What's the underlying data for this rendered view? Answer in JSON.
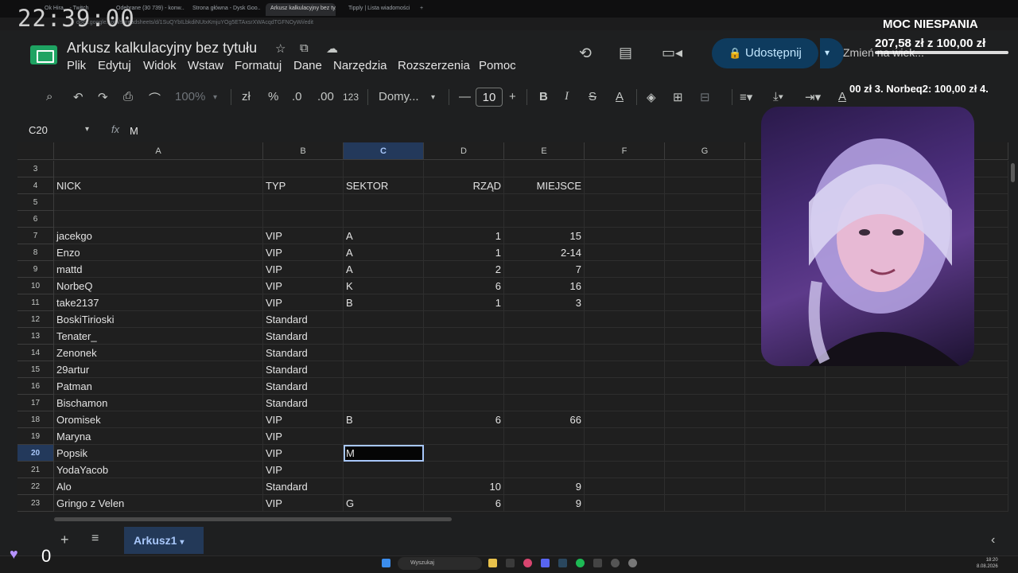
{
  "clock": "22:39:00",
  "browser_tabs": [
    "Ok Hira... - Twitch",
    "Odebrane (30 739) - konw...",
    "Strona główna - Dysk Goo...",
    "Arkusz kalkulacyjny bez ty...",
    "Tipply | Lista wiadomości"
  ],
  "url": "docs.google.com/spreadsheets/d/1SuQYbILbkdiNUtxKmjuYOg5ETAxsrXWAcqdTGFNOyWi/edit",
  "doc_title": "Arkusz kalkulacyjny bez tytułu",
  "menu": [
    "Plik",
    "Edytuj",
    "Widok",
    "Wstaw",
    "Formatuj",
    "Dane",
    "Narzędzia",
    "Rozszerzenia",
    "Pomoc"
  ],
  "share_label": "Udostępnij",
  "rename_label": "Zmień na wiek...",
  "toolbar": {
    "zoom": "100%",
    "currency": "zł",
    "percent": "%",
    "dec_less": ".0",
    "dec_more": ".00",
    "format": "123",
    "font": "Domy...",
    "font_size": "10"
  },
  "namebox": "C20",
  "formula_value": "M",
  "columns": [
    "A",
    "B",
    "C",
    "D",
    "E",
    "F",
    "G"
  ],
  "rows": [
    {
      "n": "3",
      "a": "",
      "b": "",
      "c": "",
      "d": "",
      "e": ""
    },
    {
      "n": "4",
      "a": "NICK",
      "b": "TYP",
      "c": "SEKTOR",
      "d": "RZĄD",
      "e": "MIEJSCE"
    },
    {
      "n": "5",
      "a": "",
      "b": "",
      "c": "",
      "d": "",
      "e": ""
    },
    {
      "n": "6",
      "a": "",
      "b": "",
      "c": "",
      "d": "",
      "e": ""
    },
    {
      "n": "7",
      "a": "jacekgo",
      "b": "VIP",
      "c": "A",
      "d": "1",
      "e": "15"
    },
    {
      "n": "8",
      "a": "Enzo",
      "b": "VIP",
      "c": "A",
      "d": "1",
      "e": "2-14"
    },
    {
      "n": "9",
      "a": "mattd",
      "b": "VIP",
      "c": "A",
      "d": "2",
      "e": "7"
    },
    {
      "n": "10",
      "a": "NorbeQ",
      "b": "VIP",
      "c": "K",
      "d": "6",
      "e": "16"
    },
    {
      "n": "11",
      "a": "take2137",
      "b": "VIP",
      "c": "B",
      "d": "1",
      "e": "3"
    },
    {
      "n": "12",
      "a": "BoskiTirioski",
      "b": "Standard",
      "c": "",
      "d": "",
      "e": ""
    },
    {
      "n": "13",
      "a": "Tenater_",
      "b": "Standard",
      "c": "",
      "d": "",
      "e": ""
    },
    {
      "n": "14",
      "a": "Zenonek",
      "b": "Standard",
      "c": "",
      "d": "",
      "e": ""
    },
    {
      "n": "15",
      "a": "29artur",
      "b": "Standard",
      "c": "",
      "d": "",
      "e": ""
    },
    {
      "n": "16",
      "a": "Patman",
      "b": "Standard",
      "c": "",
      "d": "",
      "e": ""
    },
    {
      "n": "17",
      "a": "Bischamon",
      "b": "Standard",
      "c": "",
      "d": "",
      "e": ""
    },
    {
      "n": "18",
      "a": "Oromisek",
      "b": "VIP",
      "c": "B",
      "d": "6",
      "e": "66"
    },
    {
      "n": "19",
      "a": "Maryna",
      "b": "VIP",
      "c": "",
      "d": "",
      "e": ""
    },
    {
      "n": "20",
      "a": "Popsik",
      "b": "VIP",
      "c": "M",
      "d": "",
      "e": ""
    },
    {
      "n": "21",
      "a": "YodaYacob",
      "b": "VIP",
      "c": "",
      "d": "",
      "e": ""
    },
    {
      "n": "22",
      "a": "Alo",
      "b": "Standard",
      "c": "",
      "d": "10",
      "e": "9"
    },
    {
      "n": "23",
      "a": "Gringo z Velen",
      "b": "VIP",
      "c": "G",
      "d": "6",
      "e": "9"
    }
  ],
  "selected_row": "20",
  "selected_col": "C",
  "sheet_tab": "Arkusz1",
  "taskbar_search": "Wyszukaj",
  "taskbar_time": "18:20",
  "taskbar_date": "8.08.2026",
  "overlay": {
    "goal_title": "MOC NIESPANIA",
    "goal_amount": "207,58 zł z 100,00 zł",
    "ticker": "00 zł   3. Norbeq2: 100,00 zł   4.",
    "heartbeat_count": "0"
  },
  "colors": {
    "accent": "#a8c7fa",
    "share_bg": "#0e3b5e",
    "sheets_green": "#1ea362"
  }
}
